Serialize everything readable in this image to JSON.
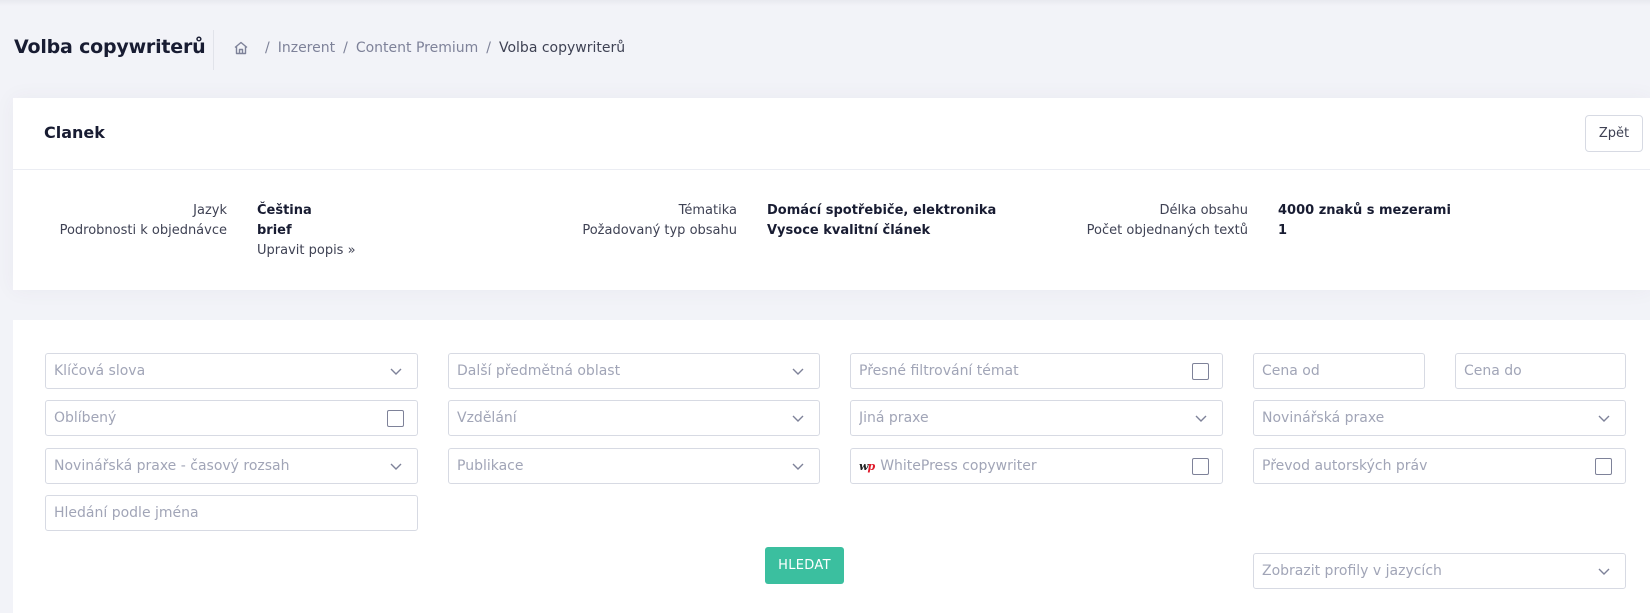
{
  "header": {
    "title": "Volba copywriterů",
    "breadcrumb": [
      "Inzerent",
      "Content Premium",
      "Volba copywriterů"
    ]
  },
  "order_card": {
    "title": "Clanek",
    "back_label": "Zpět",
    "columns": [
      {
        "rows": [
          {
            "label": "Jazyk",
            "value": "Čeština"
          },
          {
            "label": "Podrobnosti k objednávce",
            "value": "brief"
          }
        ],
        "link": "Upravit popis »"
      },
      {
        "rows": [
          {
            "label": "Tématika",
            "value": "Domácí spotřebiče, elektronika"
          },
          {
            "label": "Požadovaný typ obsahu",
            "value": "Vysoce kvalitní článek"
          }
        ]
      },
      {
        "rows": [
          {
            "label": "Délka obsahu",
            "value": "4000 znaků s mezerami"
          },
          {
            "label": "Počet objednaných textů",
            "value": "1"
          }
        ]
      }
    ]
  },
  "filters": {
    "keywords": "Klíčová slova",
    "other_subject_area": "Další předmětná oblast",
    "exact_topic_filter": "Přesné filtrování témat",
    "price_from": "Cena od",
    "price_to": "Cena do",
    "favorite": "Oblíbený",
    "education": "Vzdělání",
    "other_practice": "Jiná praxe",
    "journalism_practice": "Novinářská praxe",
    "journalism_time_range": "Novinářská praxe - časový rozsah",
    "publications": "Publikace",
    "whitepress_copywriter": "WhitePress copywriter",
    "copyright_transfer": "Převod autorských práv",
    "name_search": "Hledání podle jména",
    "profile_languages": "Zobrazit profily v jazycích"
  },
  "search_label": "HLEDAT",
  "icons": {
    "home": "home-icon",
    "dropdown": "chevron-down-icon",
    "checkbox": "checkbox-icon",
    "whitepress": "whitepress-logo-icon"
  },
  "colors": {
    "accent": "#3bbf9f",
    "background": "#f2f3f8",
    "whitepress_red": "#e01b2b"
  }
}
